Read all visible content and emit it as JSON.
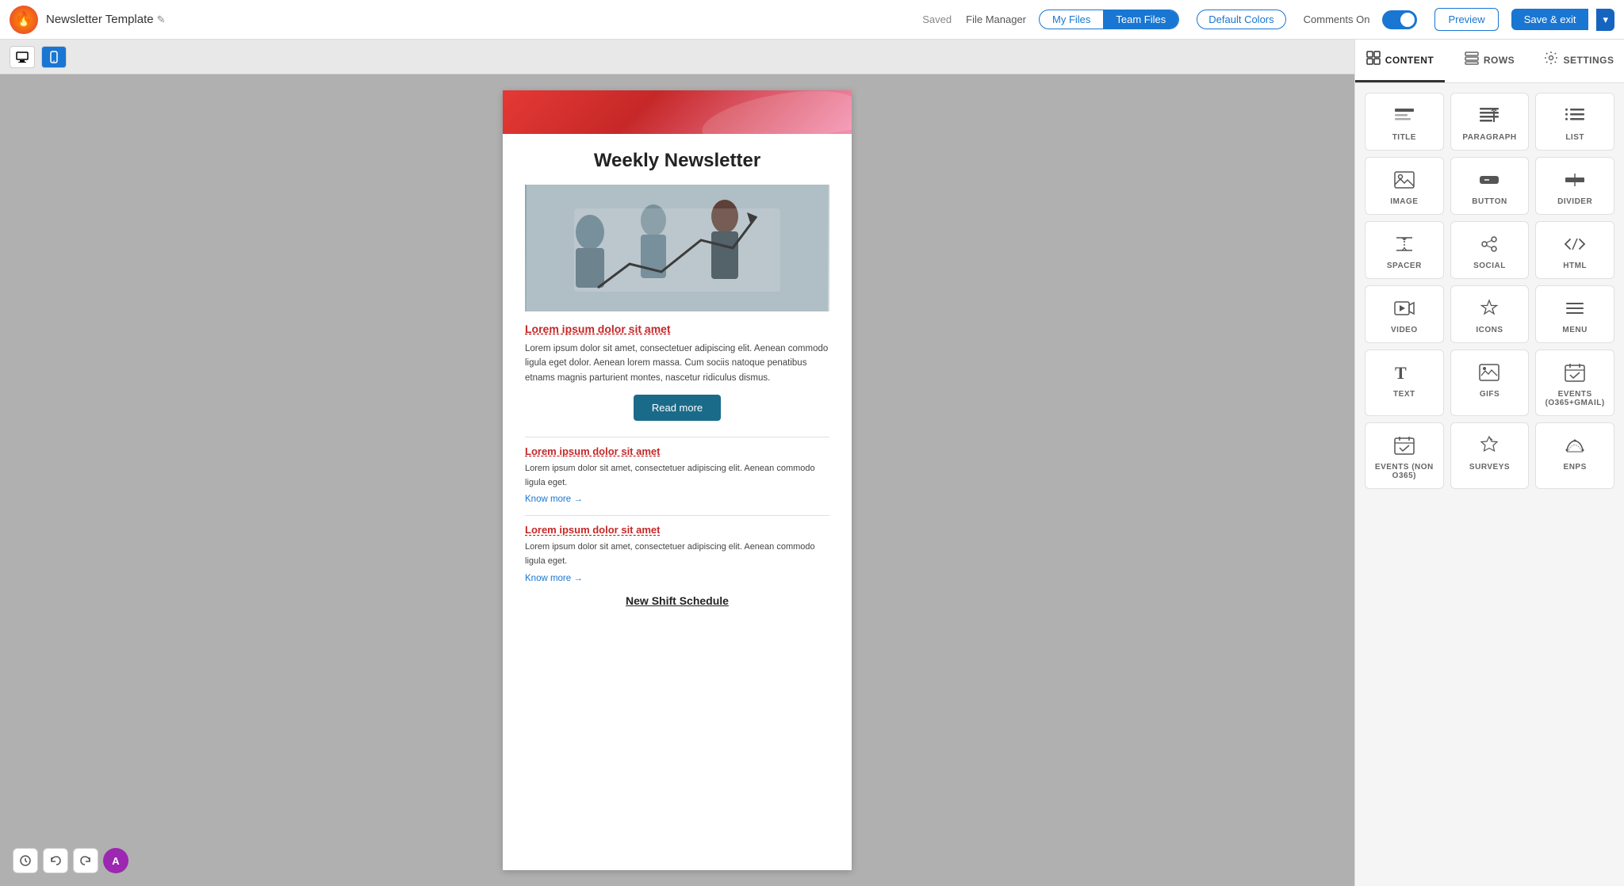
{
  "topbar": {
    "logo_emoji": "🔥",
    "title": "Newsletter Template",
    "edit_icon": "✎",
    "saved_label": "Saved",
    "file_manager_label": "File Manager",
    "my_files_label": "My Files",
    "team_files_label": "Team Files",
    "default_colors_label": "Default Colors",
    "comments_on_label": "Comments On",
    "preview_label": "Preview",
    "save_exit_label": "Save & exit",
    "dropdown_arrow": "▾"
  },
  "canvas_toolbar": {
    "desktop_icon": "🖥",
    "mobile_icon": "📱"
  },
  "email": {
    "title": "Weekly Newsletter",
    "section1": {
      "heading": "Lorem ipsum dolor sit amet",
      "body": "Lorem ipsum dolor sit amet, consectetuer adipiscing elit. Aenean commodo ligula eget dolor. Aenean lorem massa. Cum sociis natoque penatibus etnams magnis parturient montes, nascetur ridiculus dismus.",
      "read_more_label": "Read more"
    },
    "section2": {
      "heading": "Lorem ipsum dolor sit amet",
      "body": "Lorem ipsum dolor sit amet, consectetuer adipiscing elit. Aenean commodo ligula eget.",
      "know_more_label": "Know more →"
    },
    "section3": {
      "heading": "Lorem ipsum dolor sit amet",
      "body": "Lorem ipsum dolor sit amet, consectetuer adipiscing elit. Aenean commodo ligula eget.",
      "know_more_label": "Know more →"
    },
    "footer_title": "New Shift Schedule"
  },
  "bottom_toolbar": {
    "undo_icon": "↩",
    "redo_icon": "↪",
    "history_icon": "⏱",
    "avatar_label": "A"
  },
  "right_panel": {
    "tabs": [
      {
        "id": "content",
        "label": "CONTENT",
        "icon": "▦",
        "active": true
      },
      {
        "id": "rows",
        "label": "ROWS",
        "icon": "≡",
        "active": false
      },
      {
        "id": "settings",
        "label": "SETTINGS",
        "icon": "⚙",
        "active": false
      }
    ],
    "content_blocks": [
      {
        "id": "title",
        "label": "TITLE",
        "icon_type": "title"
      },
      {
        "id": "paragraph",
        "label": "PARAGRAPH",
        "icon_type": "paragraph"
      },
      {
        "id": "list",
        "label": "LIST",
        "icon_type": "list"
      },
      {
        "id": "image",
        "label": "IMAGE",
        "icon_type": "image"
      },
      {
        "id": "button",
        "label": "BUTTON",
        "icon_type": "button"
      },
      {
        "id": "divider",
        "label": "DIVIDER",
        "icon_type": "divider"
      },
      {
        "id": "spacer",
        "label": "SPACER",
        "icon_type": "spacer"
      },
      {
        "id": "social",
        "label": "SOCIAL",
        "icon_type": "social"
      },
      {
        "id": "html",
        "label": "HTML",
        "icon_type": "html"
      },
      {
        "id": "video",
        "label": "VIDEO",
        "icon_type": "video"
      },
      {
        "id": "icons",
        "label": "ICONS",
        "icon_type": "icons"
      },
      {
        "id": "menu",
        "label": "MENU",
        "icon_type": "menu"
      },
      {
        "id": "text",
        "label": "TEXT",
        "icon_type": "text"
      },
      {
        "id": "gifs",
        "label": "GIFS",
        "icon_type": "gifs"
      },
      {
        "id": "events_365",
        "label": "EVENTS\n(O365+GMAIL)",
        "icon_type": "events365"
      },
      {
        "id": "events_non",
        "label": "EVENTS (NON O365)",
        "icon_type": "events_non"
      },
      {
        "id": "surveys",
        "label": "SURVEYS",
        "icon_type": "surveys"
      },
      {
        "id": "enps",
        "label": "ENPS",
        "icon_type": "enps"
      }
    ]
  }
}
